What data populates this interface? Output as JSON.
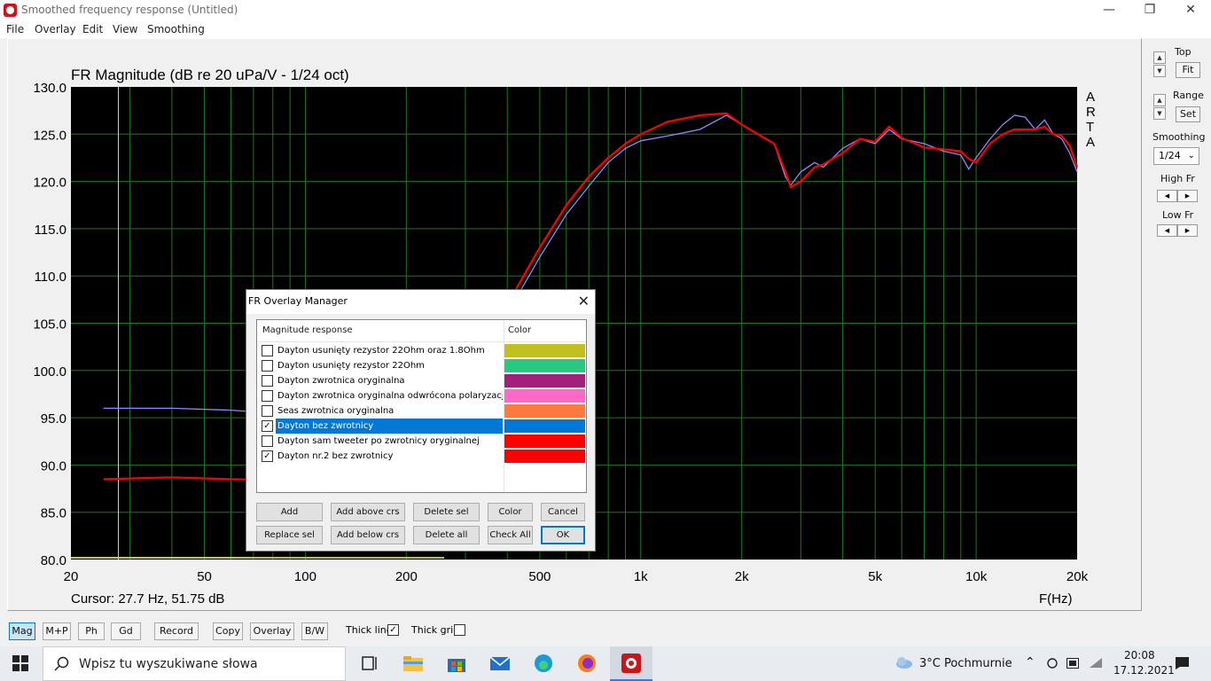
{
  "window": {
    "title": "Smoothed frequency response (Untitled)"
  },
  "menu": [
    "File",
    "Overlay",
    "Edit",
    "View",
    "Smoothing"
  ],
  "chart_data": {
    "type": "line",
    "title": "FR Magnitude (dB re 20 uPa/V - 1/24 oct)",
    "xlabel": "F(Hz)",
    "ylabel": "",
    "x_scale": "log",
    "xlim": [
      20,
      20000
    ],
    "ylim": [
      80,
      130
    ],
    "x_ticks": [
      "20",
      "50",
      "100",
      "200",
      "500",
      "1k",
      "2k",
      "5k",
      "10k",
      "20k"
    ],
    "y_ticks": [
      "130.0",
      "125.0",
      "120.0",
      "115.0",
      "110.0",
      "105.0",
      "100.0",
      "95.0",
      "90.0",
      "85.0",
      "80.0"
    ],
    "watermark": "ARTA",
    "cursor_text": "Cursor: 27.7 Hz, 51.75 dB",
    "cursor_freq": 27.7,
    "grid": true,
    "series": [
      {
        "name": "Dayton bez zwrotnicy",
        "color": "#8a8aff",
        "x": [
          25,
          40,
          60,
          80,
          400,
          500,
          600,
          700,
          800,
          900,
          1000,
          1200,
          1500,
          1800,
          2000,
          2500,
          2700,
          2800,
          3000,
          3300,
          3500,
          4000,
          4500,
          5000,
          5500,
          6000,
          7000,
          8000,
          9000,
          9500,
          10000,
          11000,
          12000,
          13000,
          14000,
          15000,
          16000,
          17000,
          18000,
          19000,
          20000
        ],
        "y": [
          96.0,
          96.0,
          95.8,
          95.5,
          106.0,
          112.0,
          116.5,
          119.5,
          122.0,
          123.5,
          124.3,
          124.8,
          125.5,
          127.0,
          126.0,
          124.0,
          120.5,
          119.6,
          121.0,
          122.0,
          121.5,
          123.5,
          124.5,
          124.0,
          125.5,
          124.5,
          124.0,
          123.2,
          122.8,
          121.3,
          122.5,
          124.5,
          126.0,
          127.0,
          126.8,
          125.5,
          126.5,
          125.0,
          124.5,
          123.0,
          121.0
        ]
      },
      {
        "name": "Dayton nr.2 bez zwrotnicy",
        "color": "#ff0000",
        "x": [
          25,
          40,
          60,
          80,
          400,
          500,
          600,
          700,
          800,
          900,
          1000,
          1200,
          1500,
          1800,
          2000,
          2500,
          2700,
          2800,
          3000,
          3300,
          3500,
          4000,
          4500,
          5000,
          5500,
          6000,
          7000,
          8000,
          9000,
          9500,
          10000,
          11000,
          12000,
          13000,
          14000,
          15000,
          16000,
          17000,
          18000,
          19000,
          20000
        ],
        "y": [
          88.5,
          88.7,
          88.5,
          88.4,
          107.0,
          113.0,
          117.5,
          120.5,
          122.5,
          124.0,
          125.0,
          126.3,
          127.0,
          127.2,
          126.0,
          124.0,
          121.0,
          119.4,
          120.0,
          121.5,
          121.8,
          123.0,
          124.5,
          124.2,
          125.8,
          124.6,
          123.6,
          123.4,
          123.2,
          122.4,
          122.0,
          124.0,
          125.0,
          125.5,
          125.5,
          125.5,
          125.8,
          125.0,
          124.8,
          123.8,
          121.5
        ]
      }
    ]
  },
  "side": {
    "top_label": "Top",
    "fit_label": "Fit",
    "range_label": "Range",
    "set_label": "Set",
    "smoothing_label": "Smoothing",
    "smoothing_value": "1/24",
    "highfr_label": "High Fr",
    "lowfr_label": "Low Fr"
  },
  "bottom": {
    "buttons": [
      "Mag",
      "M+P",
      "Ph",
      "Gd",
      "Record",
      "Copy",
      "Overlay",
      "B/W"
    ],
    "thick_line_label": "Thick line",
    "thick_line_checked": true,
    "thick_grid_label": "Thick grid",
    "thick_grid_checked": false
  },
  "dialog": {
    "title": "FR Overlay Manager",
    "col_name": "Magnitude response",
    "col_color": "Color",
    "rows": [
      {
        "label": "Dayton usunięty rezystor 22Ohm oraz 1.8Ohm",
        "checked": false,
        "color": "#c0c020"
      },
      {
        "label": "Dayton usunięty rezystor 22Ohm",
        "checked": false,
        "color": "#28c880"
      },
      {
        "label": "Dayton zwrotnica oryginalna",
        "checked": false,
        "color": "#a0207a"
      },
      {
        "label": "Dayton zwrotnica oryginalna odwrócona polaryzacja",
        "checked": false,
        "color": "#ff68c8"
      },
      {
        "label": "Seas zwrotnica oryginalna",
        "checked": false,
        "color": "#ff7a40"
      },
      {
        "label": "Dayton bez zwrotnicy",
        "checked": true,
        "color": "#0078d7",
        "selected": true
      },
      {
        "label": "Dayton sam tweeter po zwrotnicy oryginalnej",
        "checked": false,
        "color": "#ff0000"
      },
      {
        "label": "Dayton nr.2 bez zwrotnicy",
        "checked": true,
        "color": "#ff0000"
      }
    ],
    "buttons_row1": [
      "Add",
      "Add above crs",
      "Delete sel",
      "Color",
      "Cancel"
    ],
    "buttons_row2": [
      "Replace sel",
      "Add below crs",
      "Delete all",
      "Check All",
      "OK"
    ]
  },
  "taskbar": {
    "search_placeholder": "Wpisz tu wyszukiwane słowa",
    "weather": "3°C  Pochmurnie",
    "time": "20:08",
    "date": "17.12.2021"
  }
}
